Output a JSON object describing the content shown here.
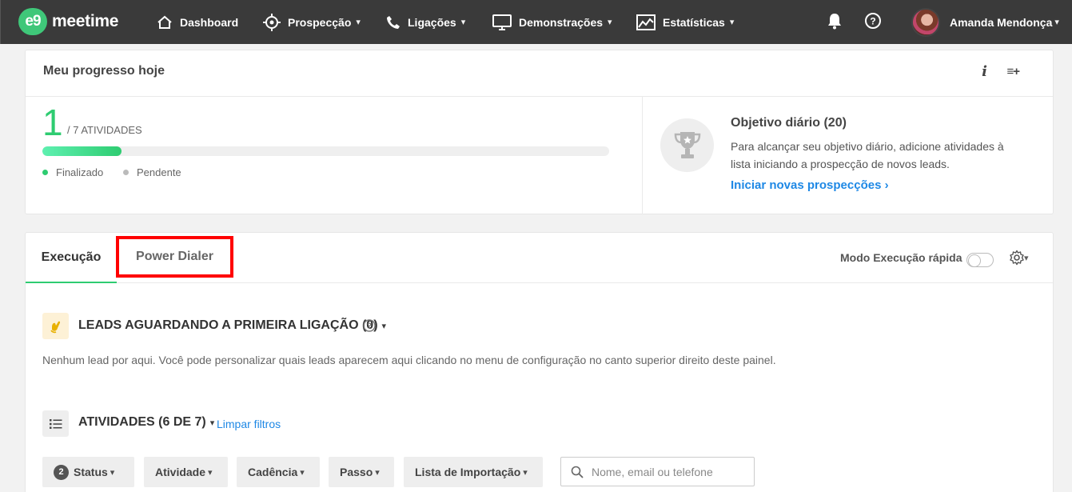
{
  "nav": {
    "logo_mark": "e9",
    "logo_text": "meetime",
    "items": [
      {
        "label": "Dashboard",
        "icon": "home-icon",
        "dropdown": false
      },
      {
        "label": "Prospecção",
        "icon": "target-icon",
        "dropdown": true
      },
      {
        "label": "Ligações",
        "icon": "phone-icon",
        "dropdown": true
      },
      {
        "label": "Demonstrações",
        "icon": "monitor-icon",
        "dropdown": true
      },
      {
        "label": "Estatísticas",
        "icon": "chart-icon",
        "dropdown": true
      }
    ],
    "user_name": "Amanda Mendonça",
    "chevron": "⌄"
  },
  "progress": {
    "title": "Meu progresso hoje",
    "info_glyph": "i",
    "add_glyph": "≡+",
    "done_count": "1",
    "total_label": "/ 7 ATIVIDADES",
    "fraction": 0.14,
    "legend_done": "Finalizado",
    "legend_pending": "Pendente",
    "colors": {
      "done": "#2ecc71",
      "pending": "#bbbbbb"
    }
  },
  "objective": {
    "title": "Objetivo diário (20)",
    "description": "Para alcançar seu objetivo diário, adicione atividades à lista iniciando a prospecção de novos leads.",
    "link": "Iniciar novas prospecções ›"
  },
  "execution": {
    "tabs": [
      {
        "label": "Execução",
        "active": true
      },
      {
        "label": "Power Dialer",
        "active": false
      }
    ],
    "quick_mode_label": "Modo Execução rápida",
    "quick_mode_on": false,
    "leads_section_title": "LEADS AGUARDANDO A PRIMEIRA LIGAÇÃO (0)",
    "empty_message": "Nenhum lead por aqui. Você pode personalizar quais leads aparecem aqui clicando no menu de configuração no canto superior direito deste painel.",
    "activities_title": "ATIVIDADES (6 DE 7)",
    "clear_filters": "Limpar filtros",
    "filters": [
      {
        "label": "Status",
        "badge": "2"
      },
      {
        "label": "Atividade",
        "badge": ""
      },
      {
        "label": "Cadência",
        "badge": ""
      },
      {
        "label": "Passo",
        "badge": ""
      },
      {
        "label": "Lista de Importação",
        "badge": ""
      }
    ],
    "search_placeholder": "Nome, email ou telefone",
    "search_value": ""
  }
}
